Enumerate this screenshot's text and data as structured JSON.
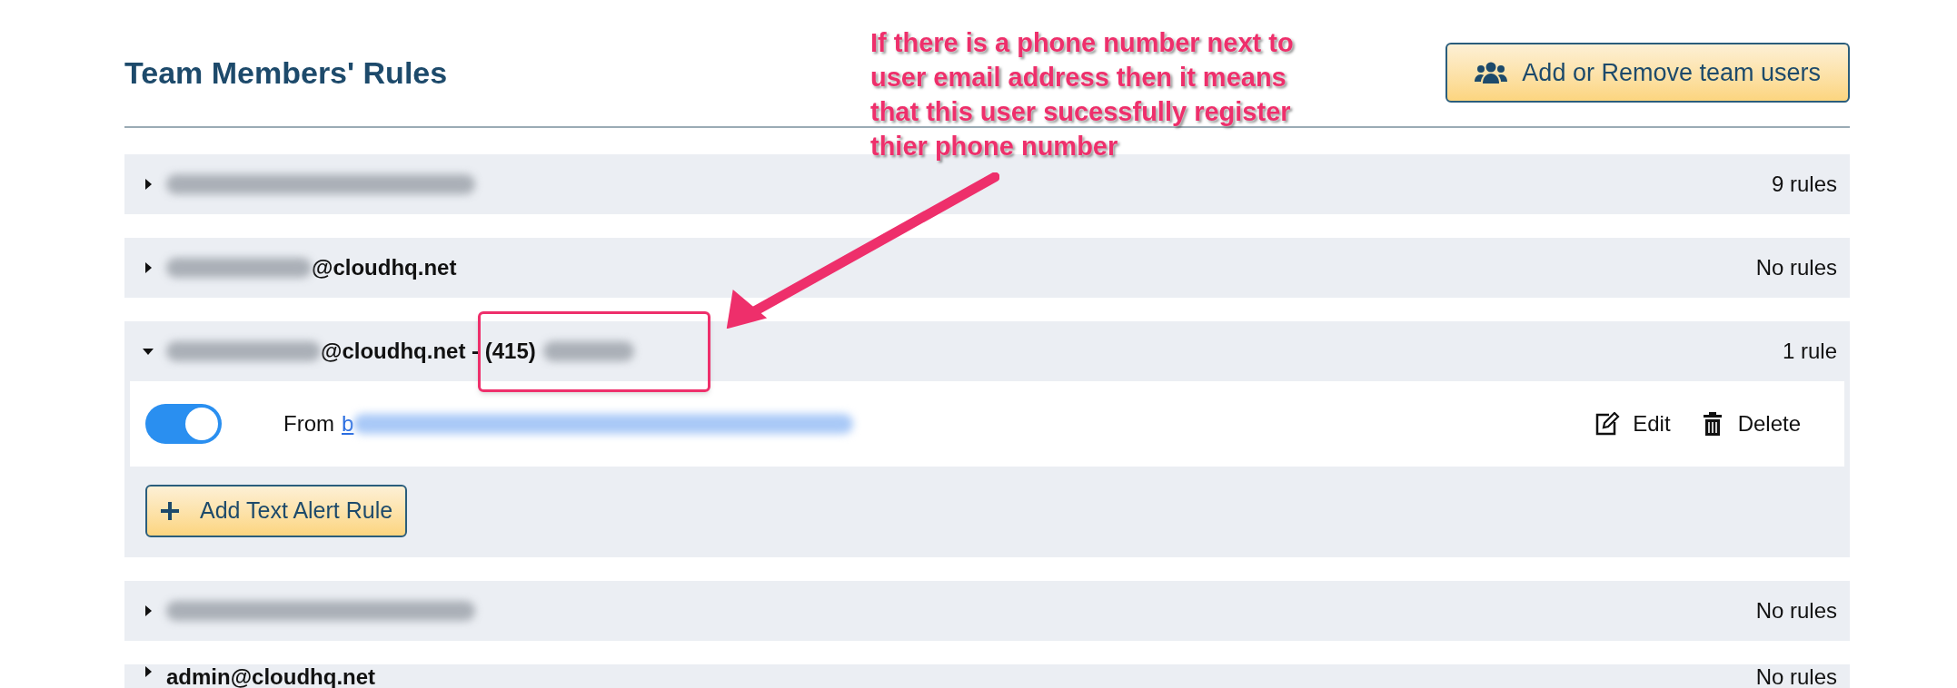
{
  "title": "Team Members' Rules",
  "add_remove_button": "Add or Remove team users",
  "members": [
    {
      "expanded": false,
      "blur_before": true,
      "count": "9 rules"
    },
    {
      "expanded": false,
      "blur_before": true,
      "email": "@cloudhq.net",
      "count": "No rules"
    },
    {
      "expanded": true,
      "blur_before": true,
      "email": "@cloudhq.net - (415)",
      "blur_after": true,
      "count": "1 rule",
      "rules": [
        {
          "enabled": true,
          "label": "From",
          "link": "b",
          "link_blurred": true,
          "edit": "Edit",
          "delete": "Delete"
        }
      ],
      "add_rule_button": "Add Text Alert Rule"
    },
    {
      "expanded": false,
      "blur_before": true,
      "count": "No rules"
    },
    {
      "expanded": false,
      "email": "admin@cloudhq.net",
      "count": "No rules"
    }
  ],
  "annotation": {
    "text": "If there is a phone number next to\nuser email address then it means\nthat this user sucessfully register\nthier phone number"
  }
}
